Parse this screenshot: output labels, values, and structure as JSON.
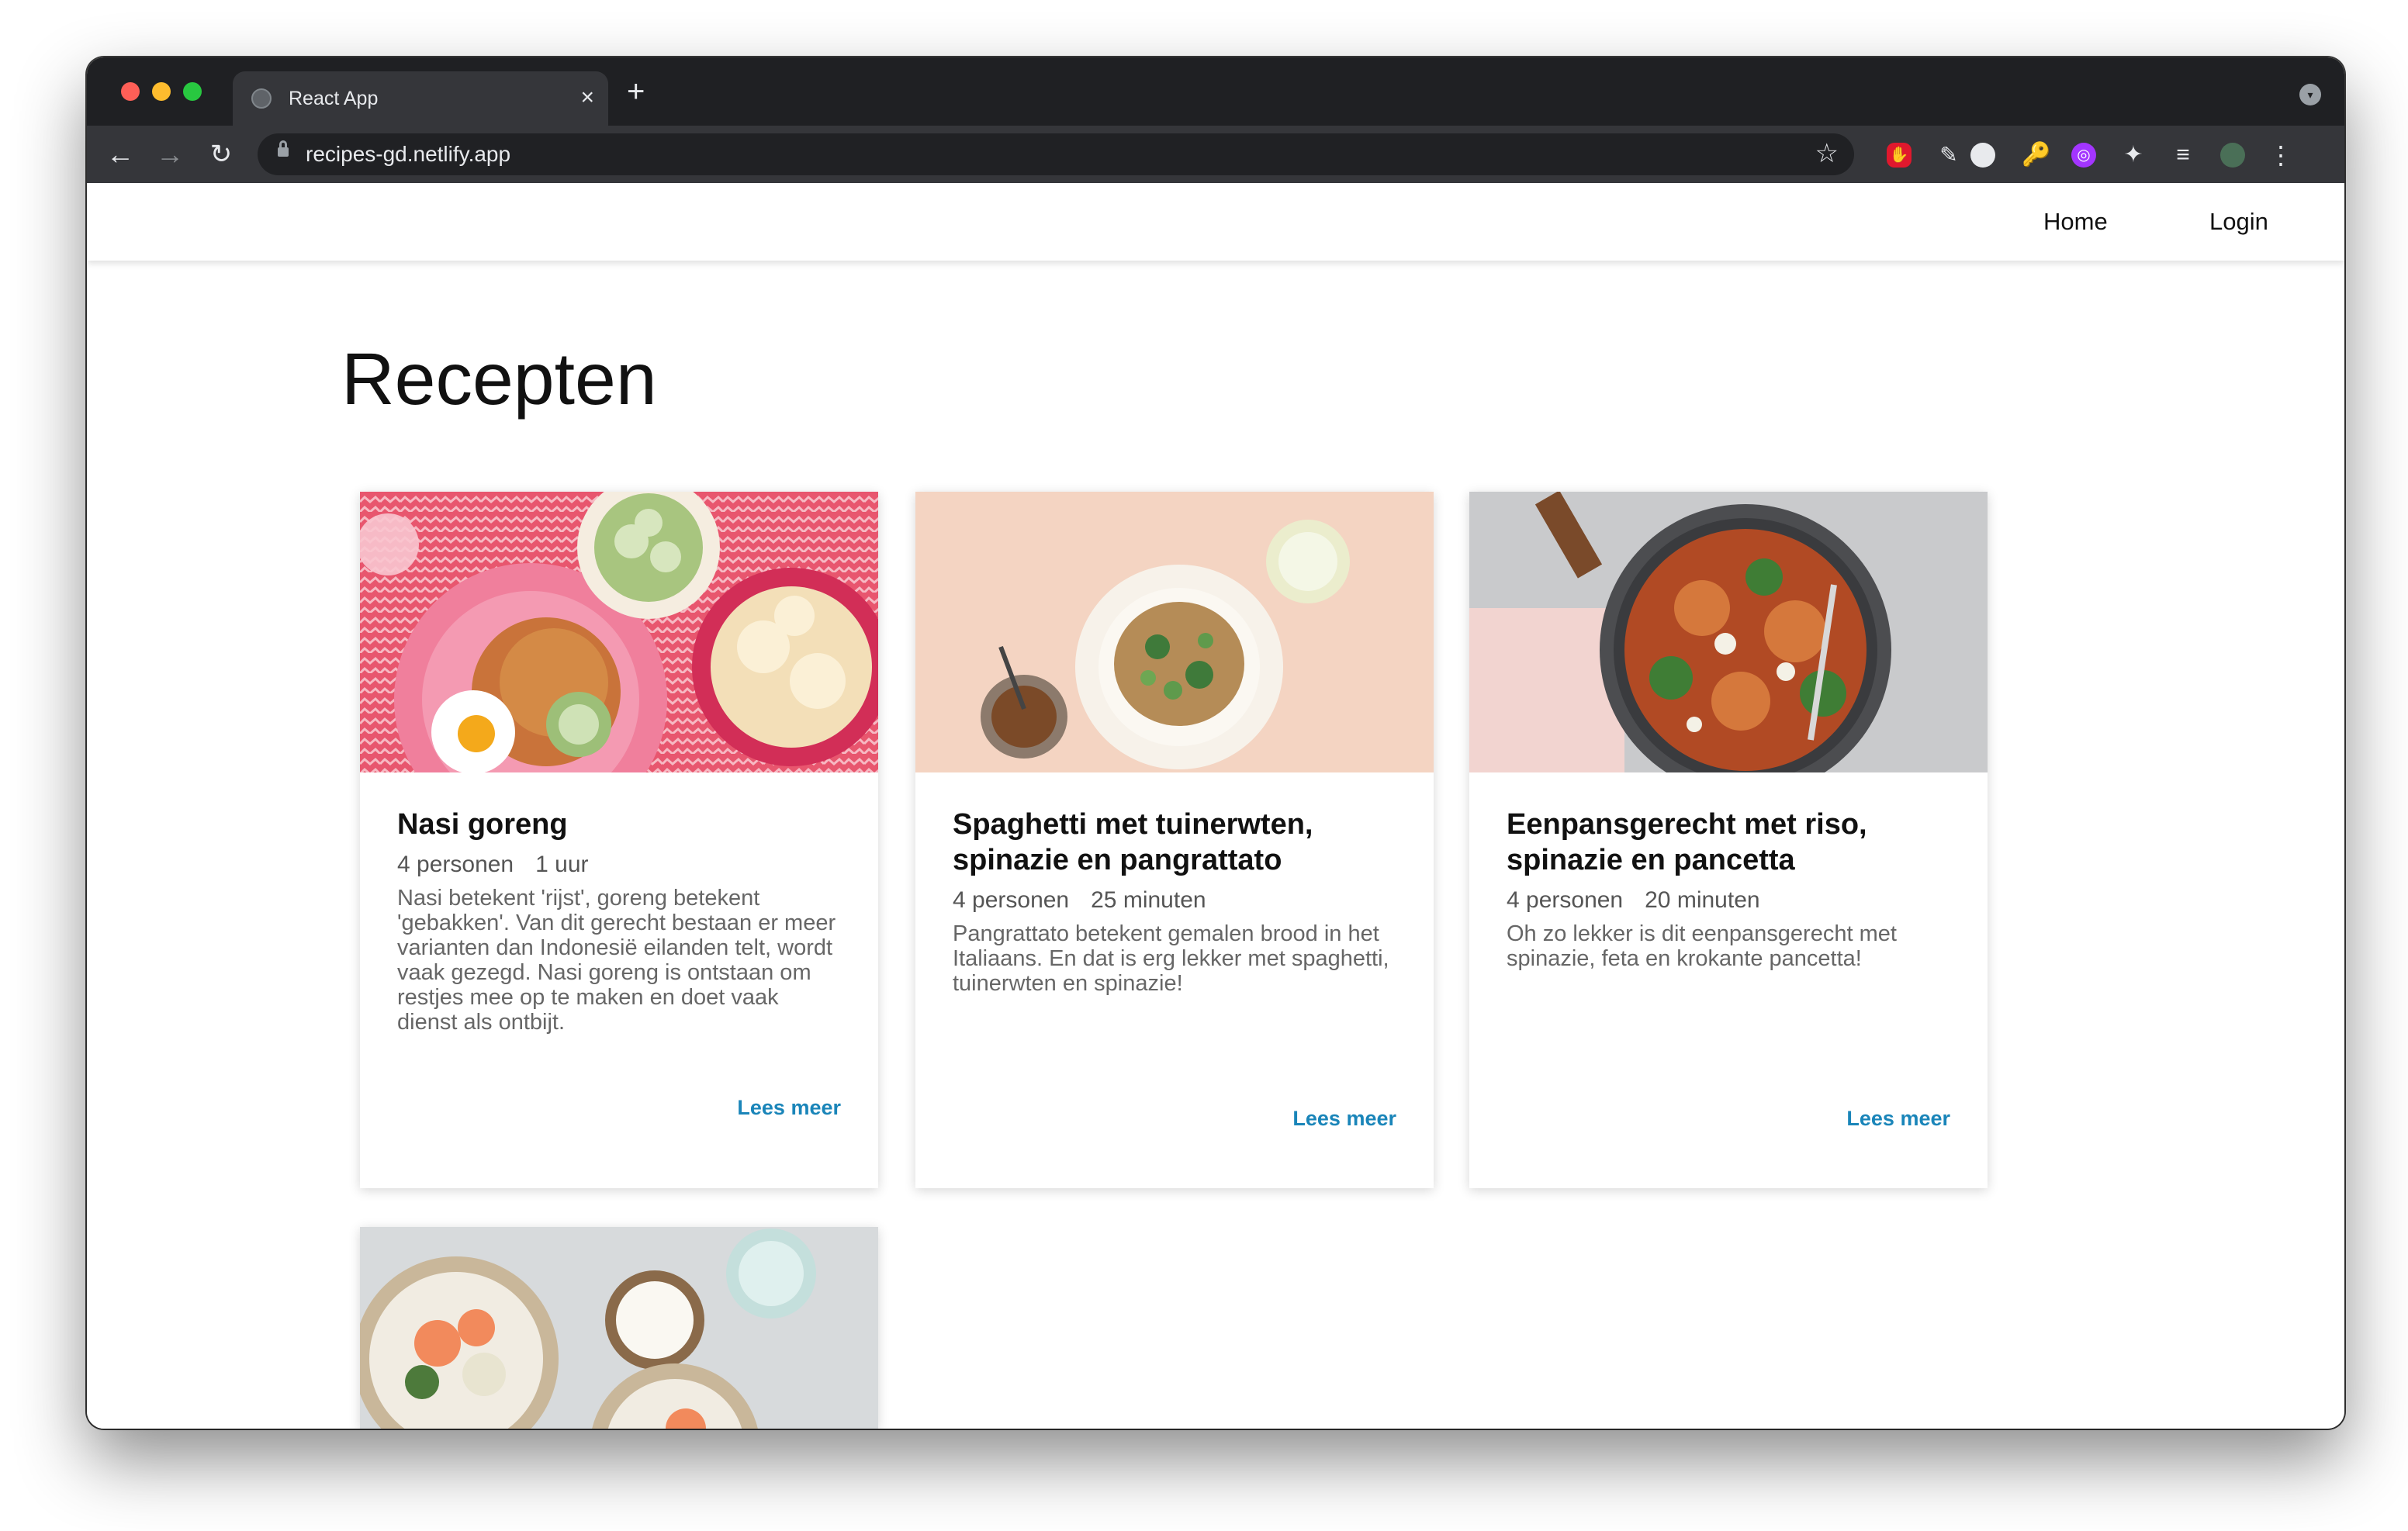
{
  "browser": {
    "tab_title": "React App",
    "tab_close_icon": "close-icon",
    "new_tab_label": "+",
    "url": "recipes-gd.netlify.app"
  },
  "nav": {
    "home": "Home",
    "login": "Login"
  },
  "main": {
    "title": "Recepten"
  },
  "recipes": [
    {
      "title": "Nasi goreng",
      "people": "4 personen",
      "time": "1 uur",
      "description": "Nasi betekent 'rijst', goreng betekent 'gebakken'. Van dit gerecht bestaan er meer varianten dan Indonesië eilanden telt, wordt vaak gezegd. Nasi goreng is ontstaan om restjes mee op te maken en doet vaak dienst als ontbijt.",
      "link": "Lees meer"
    },
    {
      "title": "Spaghetti met tuinerwten, spinazie en pangrattato",
      "people": "4 personen",
      "time": "25 minuten",
      "description": "Pangrattato betekent gemalen brood in het Italiaans. En dat is erg lekker met spaghetti, tuinerwten en spinazie!",
      "link": "Lees meer"
    },
    {
      "title": "Eenpansgerecht met riso, spinazie en pancetta",
      "people": "4 personen",
      "time": "20 minuten",
      "description": "Oh zo lekker is dit eenpansgerecht met spinazie, feta en krokante pancetta!",
      "link": "Lees meer"
    }
  ],
  "colors": {
    "link": "#1a85b9",
    "chrome_dark": "#1f2023",
    "chrome_toolbar": "#35363a"
  }
}
